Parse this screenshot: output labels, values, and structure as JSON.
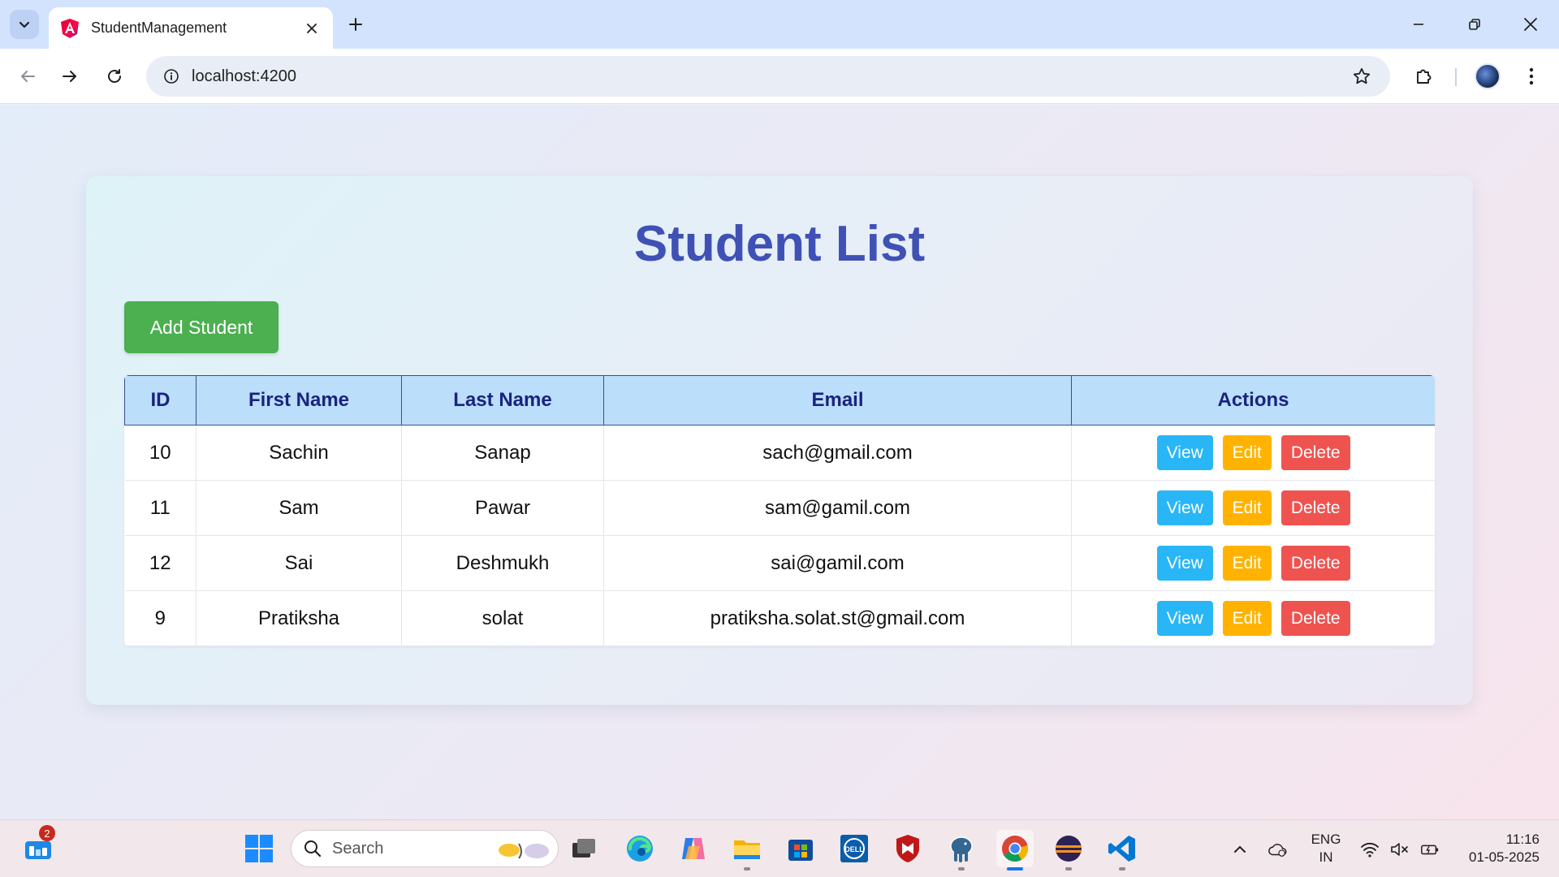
{
  "browser": {
    "tab_title": "StudentManagement",
    "url": "localhost:4200"
  },
  "page": {
    "title": "Student List",
    "add_button": "Add Student",
    "table": {
      "headers": [
        "ID",
        "First Name",
        "Last Name",
        "Email",
        "Actions"
      ],
      "rows": [
        {
          "id": "10",
          "first_name": "Sachin",
          "last_name": "Sanap",
          "email": "sach@gmail.com"
        },
        {
          "id": "11",
          "first_name": "Sam",
          "last_name": "Pawar",
          "email": "sam@gamil.com"
        },
        {
          "id": "12",
          "first_name": "Sai",
          "last_name": "Deshmukh",
          "email": "sai@gamil.com"
        },
        {
          "id": "9",
          "first_name": "Pratiksha",
          "last_name": "solat",
          "email": "pratiksha.solat.st@gmail.com"
        }
      ],
      "actions": {
        "view": "View",
        "edit": "Edit",
        "delete": "Delete"
      }
    }
  },
  "colors": {
    "title": "#3f51b5",
    "add_button": "#4caf50",
    "header_bg": "#bbdefb",
    "header_text": "#1a237e",
    "view": "#29b6f6",
    "edit": "#ffb300",
    "delete": "#ef5350"
  },
  "taskbar": {
    "widgets_badge": "2",
    "search_placeholder": "Search",
    "language": "ENG",
    "region": "IN",
    "time": "11:16",
    "date": "01-05-2025"
  }
}
